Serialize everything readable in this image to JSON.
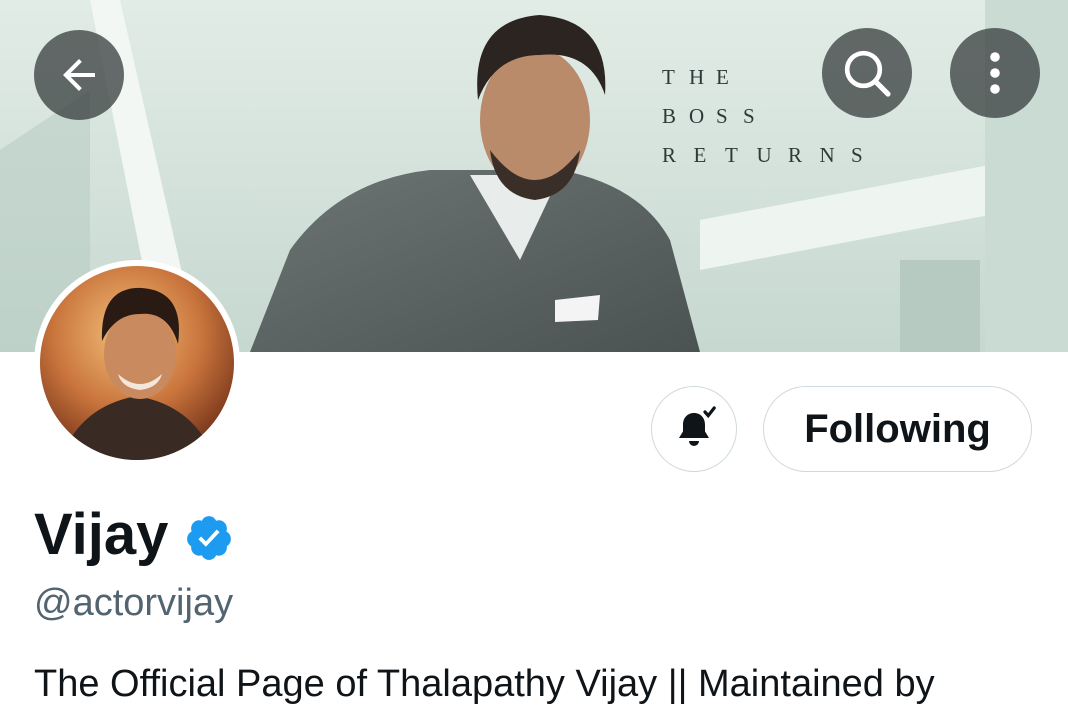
{
  "banner": {
    "tagline": [
      "T H E",
      "B O S S",
      "R E T U R N S"
    ],
    "background_color": "#d4e2dc"
  },
  "nav": {
    "back_icon": "arrow-left-icon",
    "search_icon": "search-icon",
    "more_icon": "more-vertical-icon"
  },
  "profile": {
    "name": "Vijay",
    "verified_icon": "verified-badge-icon",
    "verified_color": "#1d9bf0",
    "handle": "@actorvijay",
    "bio": "The Official Page of Thalapathy Vijay || Maintained by"
  },
  "actions": {
    "notifications_icon": "bell-subscribed-icon",
    "following_label": "Following"
  }
}
